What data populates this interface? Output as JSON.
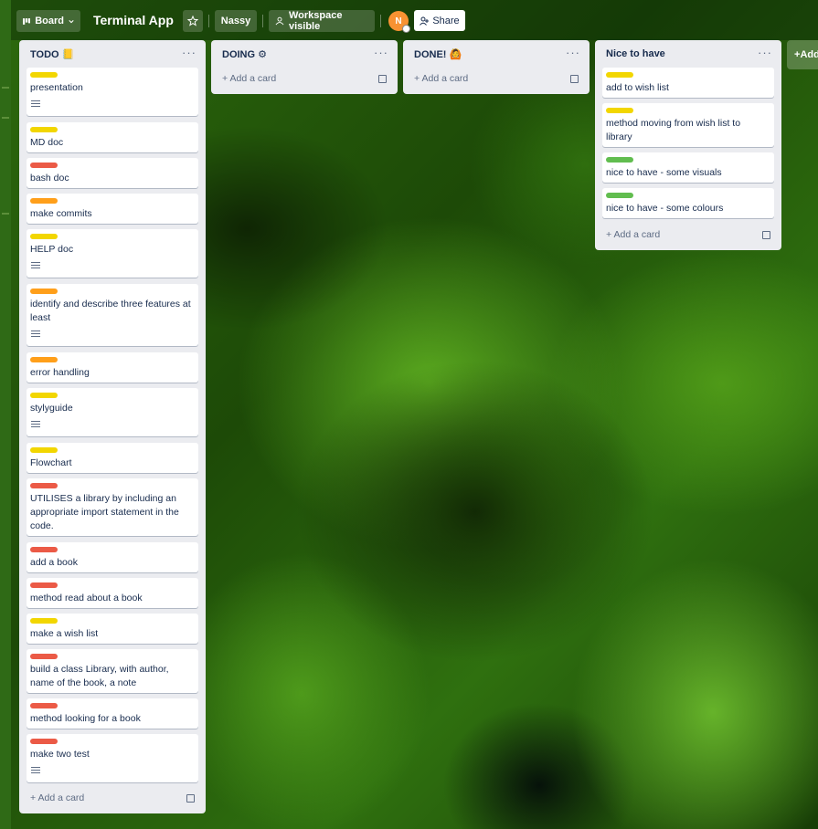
{
  "header": {
    "view_label": "Board",
    "board_title": "Terminal App",
    "workspace_name": "Nassy",
    "visibility_label": "Workspace visible",
    "avatar_initial": "N",
    "share_label": "Share"
  },
  "colors": {
    "yellow": "#f2d600",
    "red": "#eb5a46",
    "orange": "#ff9f1a",
    "green": "#61bd4f"
  },
  "lists": [
    {
      "title": "TODO 📒",
      "add_label": "Add a card",
      "cards": [
        {
          "text": "presentation",
          "label": "yellow"
        },
        {
          "text": "MD doc",
          "label": "yellow"
        },
        {
          "text": "bash doc",
          "label": "red"
        },
        {
          "text": "make commits",
          "label": "orange"
        },
        {
          "text": "HELP doc",
          "label": "yellow"
        },
        {
          "text": "identify and describe three features at least",
          "label": "orange"
        },
        {
          "text": "error handling",
          "label": "orange"
        },
        {
          "text": "stylyguide",
          "label": "yellow"
        },
        {
          "text": "Flowchart",
          "label": "yellow"
        },
        {
          "text": "UTILISES a library by including an appropriate import statement in the code.",
          "label": "red"
        },
        {
          "text": "add a book",
          "label": "red"
        },
        {
          "text": "method read about a book",
          "label": "red"
        },
        {
          "text": "make a wish list",
          "label": "yellow"
        },
        {
          "text": "build a class Library, with author, name of the book, a note",
          "label": "red"
        },
        {
          "text": "method looking for a book",
          "label": "red"
        },
        {
          "text": "make two test",
          "label": "red"
        }
      ]
    },
    {
      "title": "DOING ⚙",
      "add_label": "Add a card",
      "cards": []
    },
    {
      "title": "DONE! 🙆",
      "add_label": "Add a card",
      "cards": []
    },
    {
      "title": "Nice to have",
      "add_label": "Add a card",
      "cards": [
        {
          "text": "add to wish list",
          "label": "yellow"
        },
        {
          "text": "method moving from wish list to library",
          "label": "yellow"
        },
        {
          "text": "nice to have - some visuals",
          "label": "green"
        },
        {
          "text": "nice to have - some colours",
          "label": "green"
        }
      ]
    }
  ],
  "add_list_label": "Add another list",
  "icons": [
    "board-icon",
    "chevron-down-icon",
    "star-icon",
    "people-icon",
    "share-icon",
    "ellipsis-icon",
    "plus-icon",
    "template-icon",
    "description-icon"
  ]
}
